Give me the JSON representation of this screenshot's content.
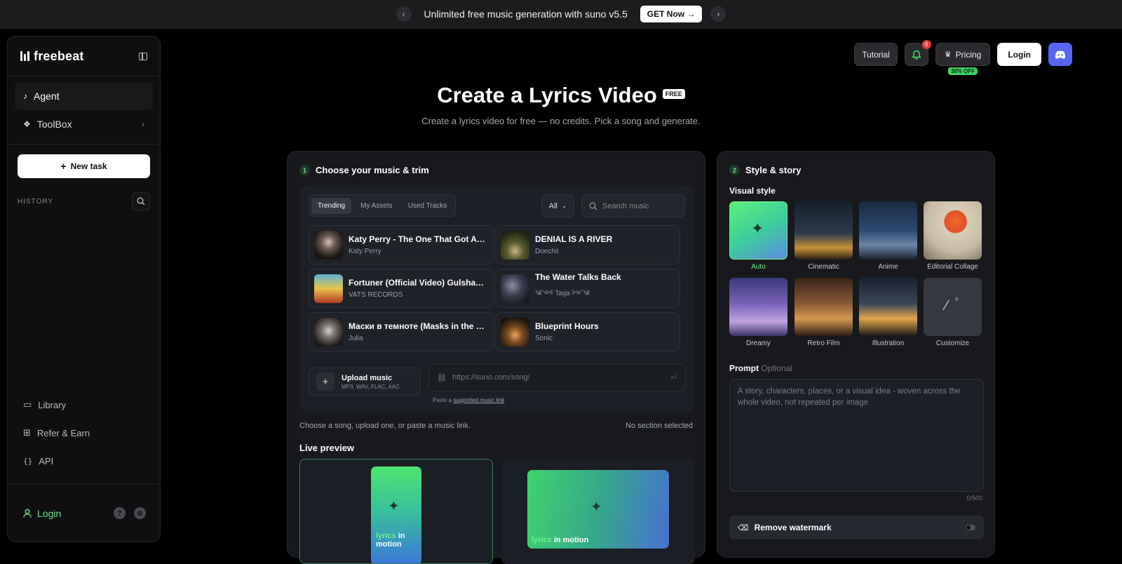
{
  "banner": {
    "message": "Unlimited free music generation with suno v5.5",
    "cta": "GET Now →"
  },
  "sidebar": {
    "brand": "freebeat",
    "nav": [
      {
        "label": "Agent"
      },
      {
        "label": "ToolBox"
      }
    ],
    "new_task": "New task",
    "history_label": "HISTORY",
    "bottom_nav": [
      {
        "label": "Library"
      },
      {
        "label": "Refer & Earn"
      },
      {
        "label": "API"
      }
    ],
    "login": "Login"
  },
  "topbar": {
    "tutorial": "Tutorial",
    "notifications": "6",
    "pricing": "Pricing",
    "pricing_badge": "30% OFF",
    "login": "Login"
  },
  "hero": {
    "title": "Create a Lyrics Video",
    "badge": "FREE",
    "subtitle": "Create a lyrics video for free — no credits. Pick a song and generate."
  },
  "music": {
    "step": "1",
    "title": "Choose your music & trim",
    "tabs": [
      "Trending",
      "My Assets",
      "Used Tracks"
    ],
    "filter": "All",
    "search_placeholder": "Search music",
    "tracks": [
      {
        "title": "Katy Perry - The One That Got Away",
        "artist": "Katy Perry"
      },
      {
        "title": "DENIAL IS A RIVER",
        "artist": "Doechii"
      },
      {
        "title": "Fortuner (Official Video) Gulshan Music",
        "artist": "VATS RECORDS"
      },
      {
        "title": "The Water Talks Back",
        "artist": "༄༺ Taıja ༻༄"
      },
      {
        "title": "Маски в темноте (Masks in the Dark)",
        "artist": "Julia"
      },
      {
        "title": "Blueprint Hours",
        "artist": "Sonic"
      }
    ],
    "upload_title": "Upload music",
    "upload_formats": "MP3, WAV, FLAC, AAC",
    "link_placeholder": "https://suno.com/song/",
    "paste_prefix": "Paste a",
    "paste_link": "supported music link",
    "hint": "Choose a song, upload one, or paste a music link.",
    "section_status": "No section selected",
    "live_preview": "Live preview",
    "preview_word": "lyrics",
    "preview_rest_vertical": "in motion",
    "preview_rest_wide": "in motion"
  },
  "style": {
    "step": "2",
    "title": "Style & story",
    "visual_style_label": "Visual style",
    "styles": [
      "Auto",
      "Cinematic",
      "Anime",
      "Editorial Collage",
      "Dreamy",
      "Retro Film",
      "Illustration",
      "Customize"
    ],
    "prompt_label": "Prompt",
    "prompt_optional": "Optional",
    "prompt_placeholder": "A story, characters, places, or a visual idea - woven across the whole video, not repeated per image",
    "counter": "0/500",
    "remove_watermark": "Remove watermark"
  },
  "colors": {
    "accent": "#4ee46f",
    "background": "#000000",
    "card": "#17191d"
  }
}
